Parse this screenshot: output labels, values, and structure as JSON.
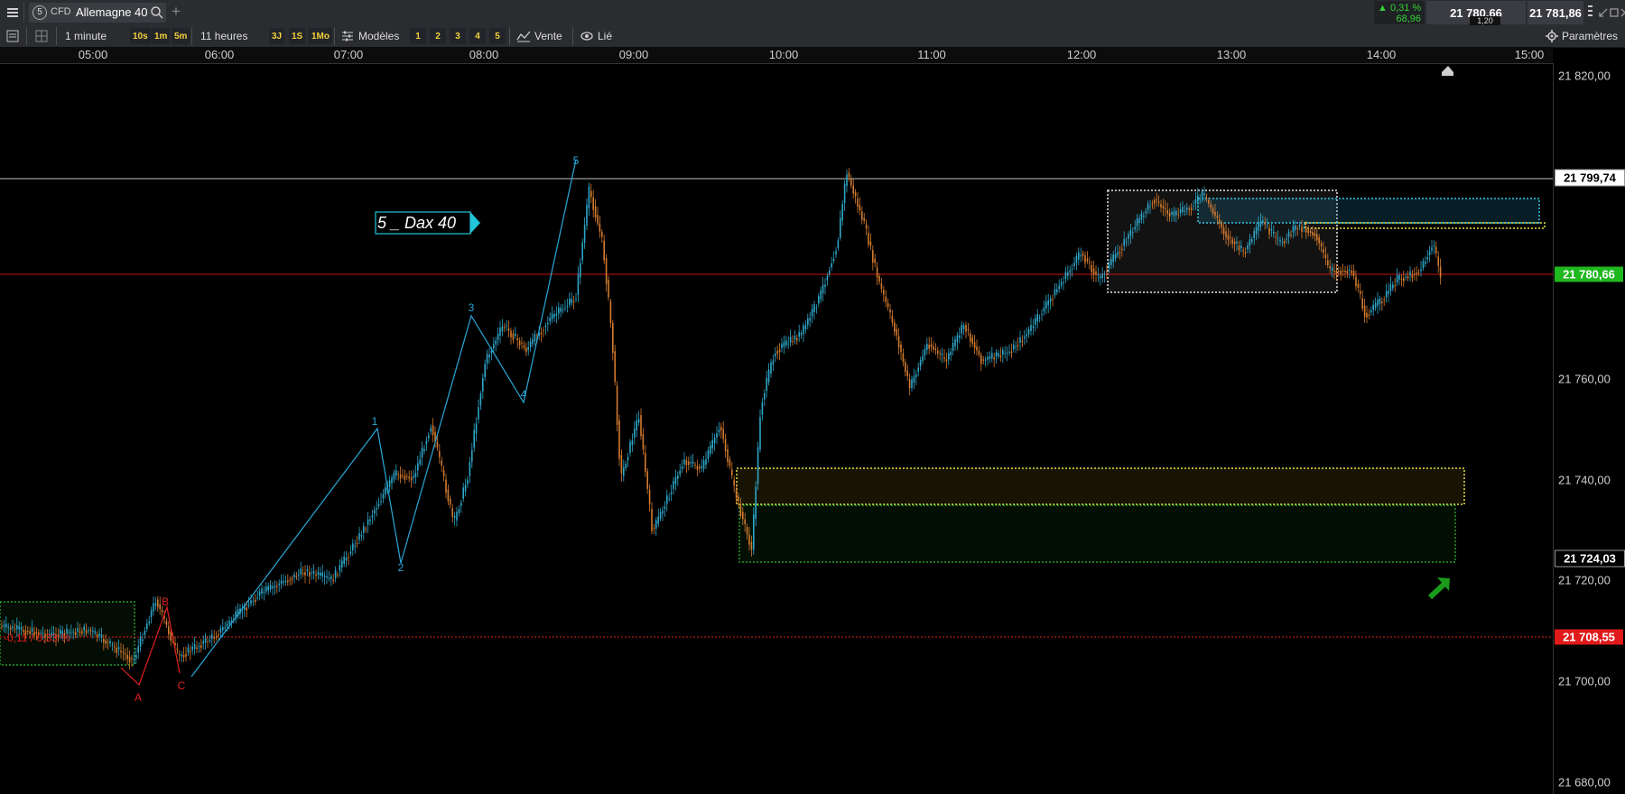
{
  "window": {
    "menu_icon": "hamburger-menu-icon",
    "badge_number": "5",
    "instrument_type": "CFD",
    "instrument_name": "Allemagne 40",
    "add_tab": "+"
  },
  "quote": {
    "change_pct": "0,31 %",
    "change_pts": "68,96",
    "bid": "21 780,66",
    "ask": "21 781,86",
    "spread": "1,20",
    "up_color": "#35d135"
  },
  "toolbar": {
    "timeframe": "1 minute",
    "quick_intervals": [
      "10s",
      "1m",
      "5m"
    ],
    "period": "11 heures",
    "quick_periods": [
      "3J",
      "1S",
      "1Mo"
    ],
    "templates_label": "Modèles",
    "template_slots": [
      "1",
      "2",
      "3",
      "4",
      "5"
    ],
    "sell_label": "Vente",
    "linked_label": "Lié",
    "settings_label": "Paramètres"
  },
  "time_axis": [
    "05:00",
    "06:00",
    "07:00",
    "08:00",
    "09:00",
    "10:00",
    "11:00",
    "12:00",
    "13:00",
    "14:00",
    "15:00"
  ],
  "price_axis": [
    "21 820,00",
    "21 760,00",
    "21 740,00",
    "21 720,00",
    "21 700,00",
    "21 680,00"
  ],
  "price_tags": {
    "white_level": "21 799,74",
    "last_price": "21 780,66",
    "black_level": "21 724,03",
    "red_level": "21 708,55",
    "last_price_color": "#1fb81f",
    "red_level_color": "#e01a1a"
  },
  "chart": {
    "callout_label": "5 _  Dax 40",
    "wave_labels_blue": [
      "1",
      "2",
      "3",
      "4",
      "5"
    ],
    "wave_labels_red": [
      "A",
      "B",
      "C"
    ],
    "range_label": "-0,11 / 0,33 %",
    "bull_color": "#2ea6c9",
    "bear_color": "#d37a2e",
    "wave_color": "#2aa8d8",
    "correction_color": "#e02020"
  }
}
